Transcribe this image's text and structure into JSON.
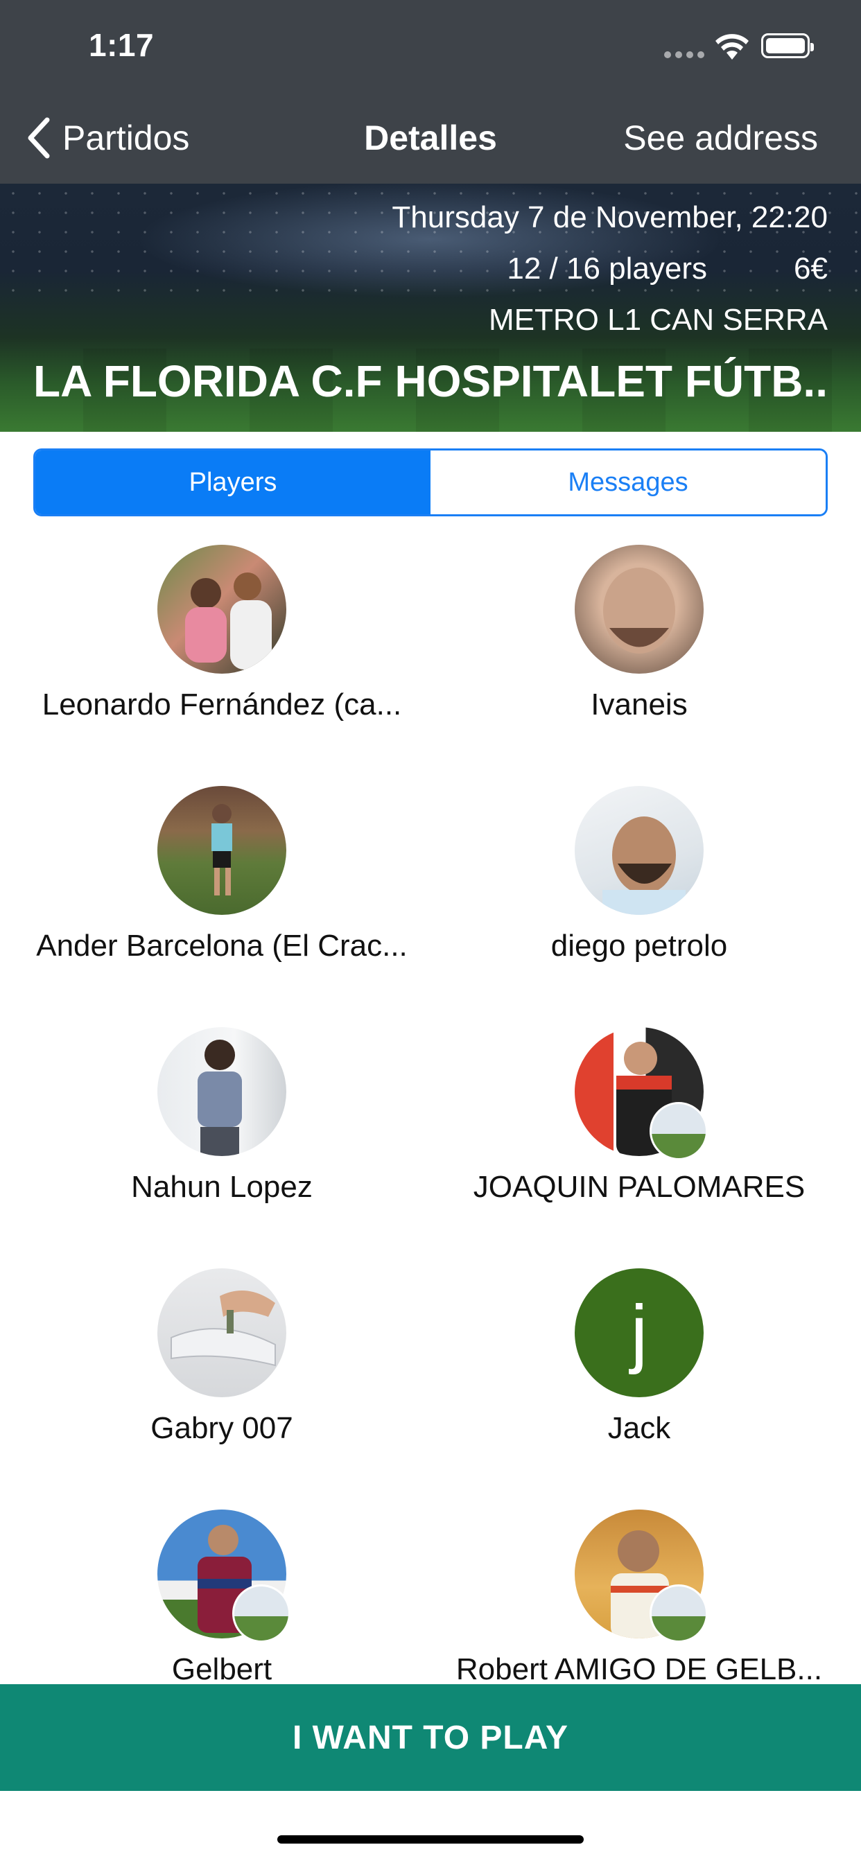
{
  "status": {
    "time": "1:17"
  },
  "nav": {
    "back_label": "Partidos",
    "title": "Detalles",
    "right_label": "See address"
  },
  "match": {
    "datetime": "Thursday 7 de November, 22:20",
    "players": "12 / 16 players",
    "price": "6€",
    "location": "METRO L1 CAN SERRA",
    "name": "LA FLORIDA C.F HOSPITALET FÚTB..."
  },
  "tabs": [
    {
      "label": "Players",
      "active": true
    },
    {
      "label": "Messages",
      "active": false
    }
  ],
  "players": [
    {
      "name": "Leonardo Fernández (ca...",
      "avatar": "photo"
    },
    {
      "name": "Ivaneis",
      "avatar": "photo"
    },
    {
      "name": "Ander Barcelona (El Crac...",
      "avatar": "photo"
    },
    {
      "name": "diego petrolo",
      "avatar": "photo"
    },
    {
      "name": "Nahun Lopez",
      "avatar": "photo"
    },
    {
      "name": "JOAQUIN PALOMARES",
      "avatar": "photo"
    },
    {
      "name": "Gabry 007",
      "avatar": "photo"
    },
    {
      "name": "Jack",
      "avatar": "initial",
      "initial": "j",
      "avatar_color": "#3a6f1c"
    },
    {
      "name": "Gelbert",
      "avatar": "photo"
    },
    {
      "name": "Robert AMIGO DE GELB...",
      "avatar": "photo"
    }
  ],
  "cta": {
    "label": "I WANT TO PLAY",
    "color": "#0f8874"
  },
  "colors": {
    "accent": "#0a7cf6",
    "nav_bg": "#3e4349"
  }
}
